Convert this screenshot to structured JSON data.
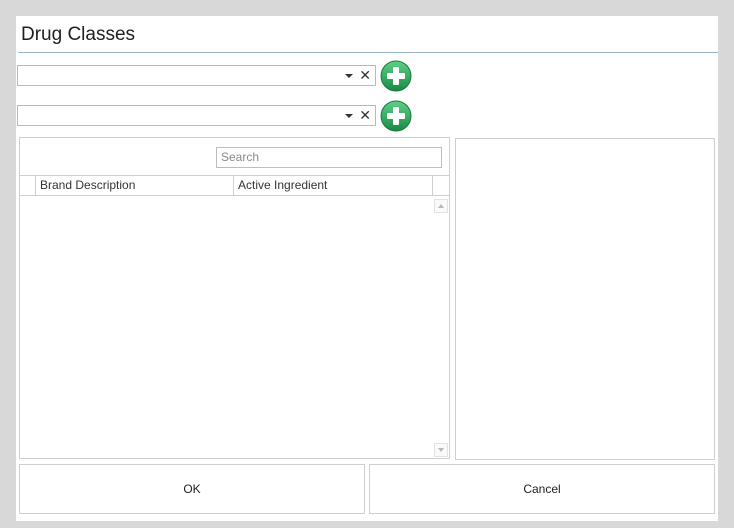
{
  "window": {
    "title": "Drug Classes"
  },
  "selectors": [
    {
      "value": "",
      "dropdown_icon": "chevron-down-icon",
      "clear_icon": "close-icon",
      "clear_glyph": "✕",
      "add_icon": "plus-circle-icon"
    },
    {
      "value": "",
      "dropdown_icon": "chevron-down-icon",
      "clear_icon": "close-icon",
      "clear_glyph": "✕",
      "add_icon": "plus-circle-icon"
    }
  ],
  "grid": {
    "search_placeholder": "Search",
    "columns": [
      "Brand Description",
      "Active Ingredient"
    ],
    "rows": []
  },
  "buttons": {
    "ok_label": "OK",
    "cancel_label": "Cancel"
  },
  "colors": {
    "add_button_green": "#2aa05a",
    "title_rule": "#9ab6cf"
  }
}
